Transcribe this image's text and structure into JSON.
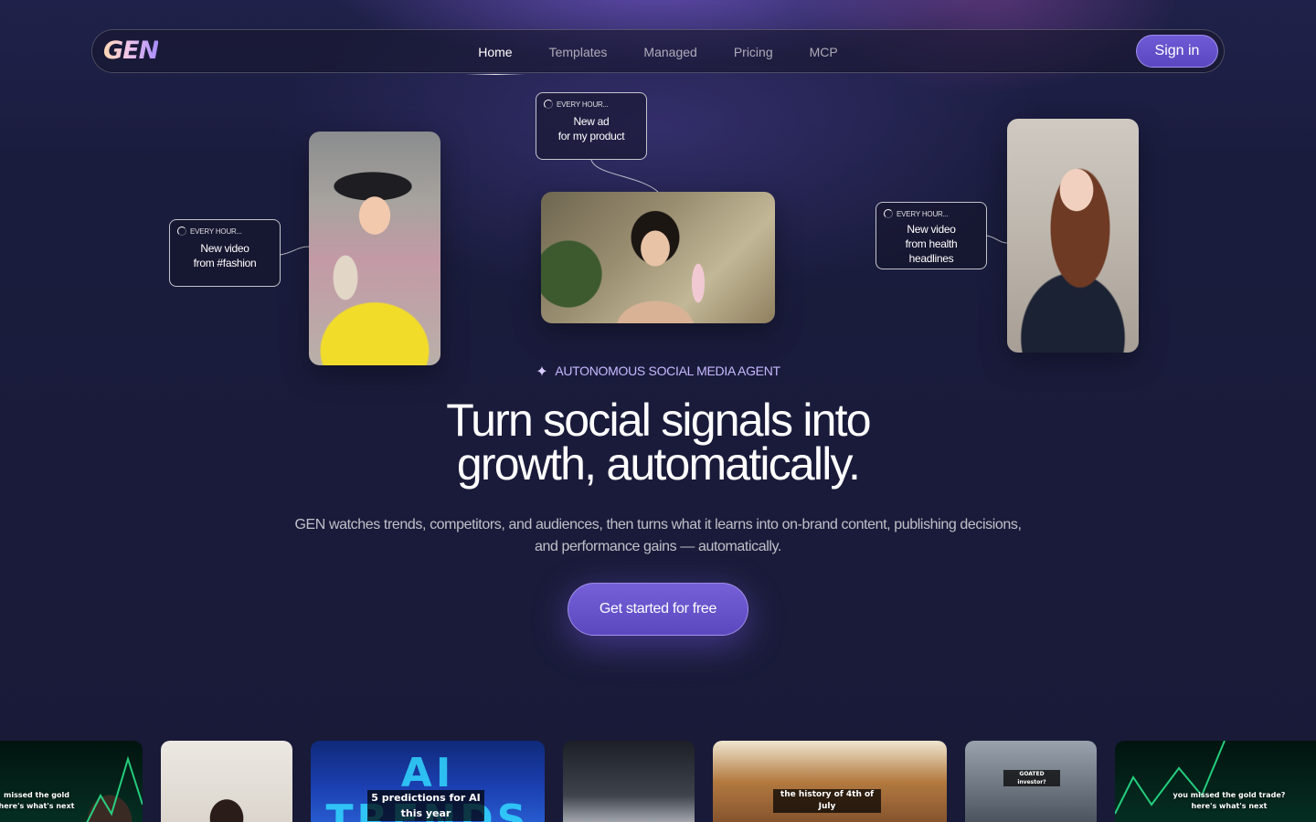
{
  "brand": {
    "logo_text": "GEN"
  },
  "nav": {
    "links": [
      {
        "label": "Home",
        "active": true
      },
      {
        "label": "Templates",
        "active": false
      },
      {
        "label": "Managed",
        "active": false
      },
      {
        "label": "Pricing",
        "active": false
      },
      {
        "label": "MCP",
        "active": false
      }
    ],
    "signin_label": "Sign in"
  },
  "hero_cards": {
    "fashion": {
      "schedule": "EVERY HOUR...",
      "text_line1": "New video",
      "text_line2": "from #fashion"
    },
    "product": {
      "schedule": "EVERY HOUR...",
      "text_line1": "New ad",
      "text_line2": "for my product"
    },
    "health": {
      "schedule": "EVERY HOUR...",
      "text_line1": "New video",
      "text_line2": "from health",
      "text_line3": "headlines"
    }
  },
  "hero": {
    "eyebrow": "AUTONOMOUS SOCIAL MEDIA AGENT",
    "headline_line1": "Turn social signals into",
    "headline_line2": "growth, automatically.",
    "subtext": "GEN watches trends, competitors, and audiences, then turns what it learns into on-brand content, publishing decisions, and performance gains — automatically.",
    "cta_label": "Get started for free"
  },
  "strip": {
    "t1_caption": "missed the gold here's what's next",
    "t3_caption": "5 predictions for AI this year",
    "t3_bg_text": "AI TRENDS",
    "t5_caption": "the history of 4th of July",
    "t6_caption": "GOATED investor?",
    "t7_caption": "you missed the gold trade? here's what's next"
  },
  "colors": {
    "accent": "#6f5bd6",
    "eyebrow": "#c6b9ff",
    "background": "#1a1b3a"
  }
}
